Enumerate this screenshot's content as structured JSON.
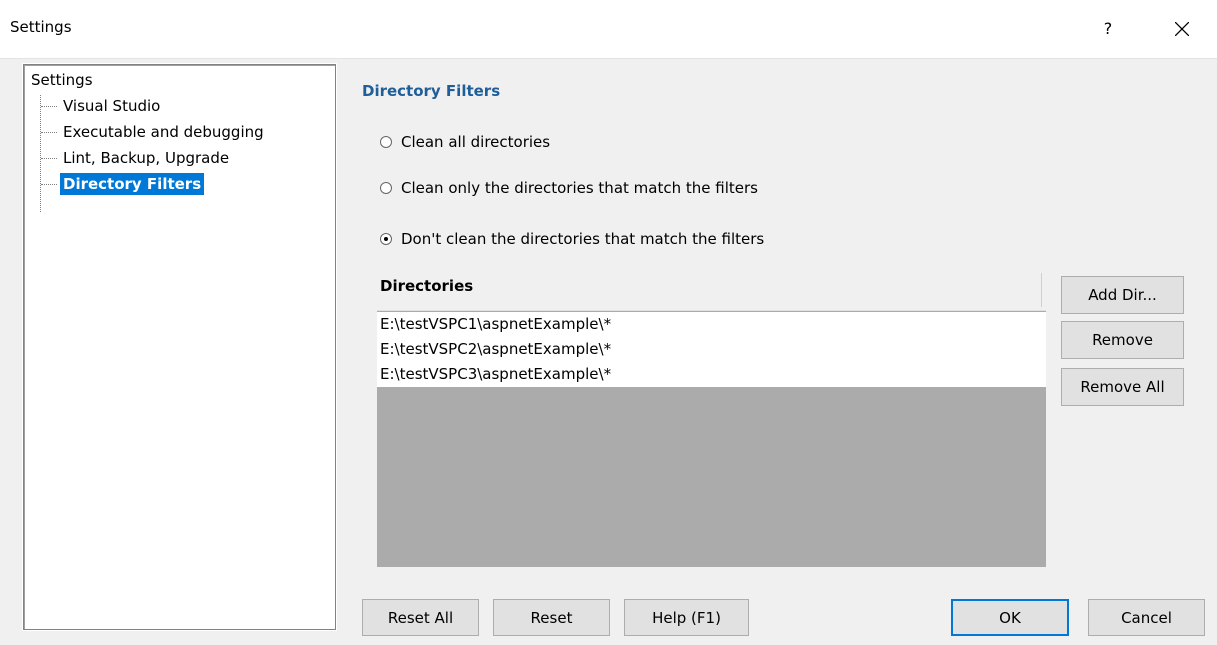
{
  "window": {
    "title": "Settings",
    "help_label": "?",
    "close_icon": "close-icon"
  },
  "tree": {
    "root": "Settings",
    "items": [
      {
        "label": "Visual Studio",
        "selected": false
      },
      {
        "label": "Executable and debugging",
        "selected": false
      },
      {
        "label": "Lint, Backup, Upgrade",
        "selected": false
      },
      {
        "label": "Directory Filters",
        "selected": true
      }
    ]
  },
  "panel": {
    "title": "Directory Filters",
    "title_color": "#1f5e99",
    "options": [
      {
        "label": "Clean all directories",
        "checked": false
      },
      {
        "label": "Clean only the directories that match the filters",
        "checked": false
      },
      {
        "label": "Don't clean the directories that match the filters",
        "checked": true
      }
    ],
    "directories": {
      "header": "Directories",
      "rows": [
        "E:\\testVSPC1\\aspnetExample\\*",
        "E:\\testVSPC2\\aspnetExample\\*",
        "E:\\testVSPC3\\aspnetExample\\*"
      ]
    },
    "side_buttons": {
      "add_dir": "Add Dir...",
      "remove": "Remove",
      "remove_all": "Remove All"
    }
  },
  "footer": {
    "reset_all": "Reset All",
    "reset": "Reset",
    "help": "Help (F1)",
    "ok": "OK",
    "cancel": "Cancel"
  },
  "colors": {
    "selection": "#0078d7",
    "list_empty_bg": "#ababab"
  }
}
